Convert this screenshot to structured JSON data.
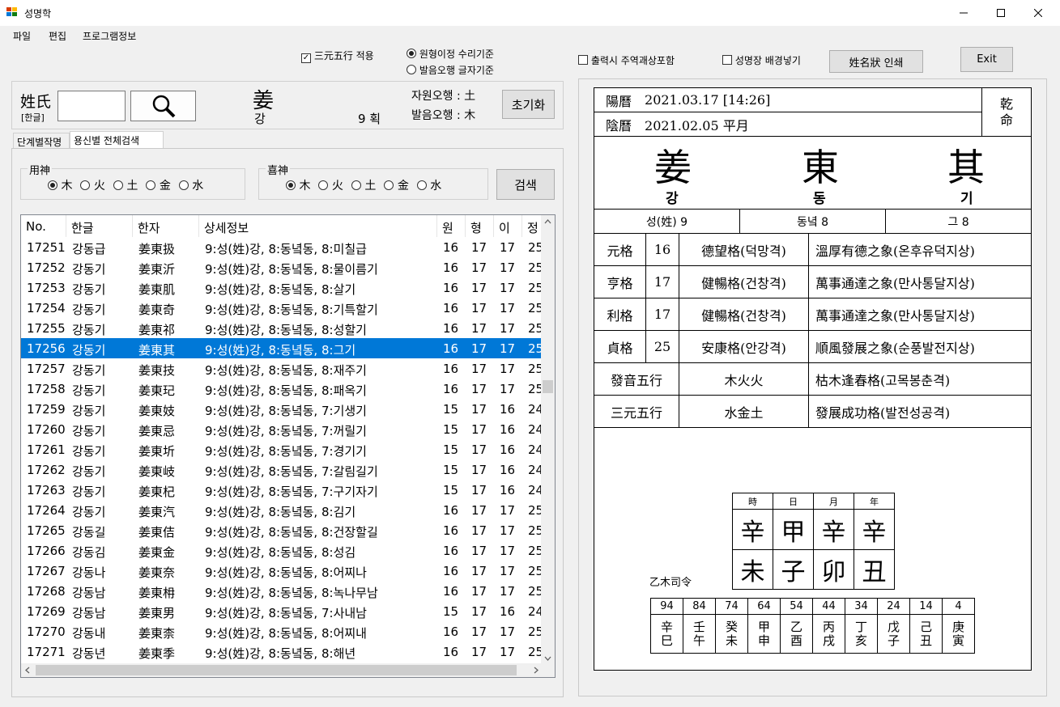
{
  "window": {
    "title": "성명학"
  },
  "menu": [
    "파일",
    "편집",
    "프로그램정보"
  ],
  "options": {
    "samwon_label": "三元五行 적용",
    "samwon_checked": true,
    "wonhyeong_label": "원형이정 수리기준",
    "baleum_label": "발음오행 글자기준",
    "print_label": "출력시 주역괘상포함",
    "bg_label": "성명장 배경넣기",
    "print_button": "姓名狀 인쇄",
    "exit_button": "Exit"
  },
  "surname": {
    "label": "姓氏",
    "sublabel": "[한글]",
    "input_value": "",
    "hanja": "姜",
    "hangul": "강",
    "strokes": "9 획",
    "jawon": "자원오행 : 土",
    "baleum": "발음오행 : 木",
    "reset_button": "초기화"
  },
  "tabs": [
    "단계별작명",
    "용신별 전체검색"
  ],
  "yongsin": {
    "title": "用神",
    "options": [
      "木",
      "火",
      "土",
      "金",
      "水"
    ],
    "selected": 0
  },
  "huisin": {
    "title": "喜神",
    "options": [
      "木",
      "火",
      "土",
      "金",
      "水"
    ],
    "selected": 0
  },
  "search_button": "검색",
  "grid": {
    "columns": [
      "No.",
      "한글",
      "한자",
      "상세정보",
      "원",
      "형",
      "이",
      "정"
    ],
    "selected_index": 5,
    "rows": [
      [
        "17251",
        "강동급",
        "姜東扱",
        "9:성(姓)강, 8:동녘동, 8:미칠급",
        "16",
        "17",
        "17",
        "25"
      ],
      [
        "17252",
        "강동기",
        "姜東沂",
        "9:성(姓)강, 8:동녘동, 8:물이름기",
        "16",
        "17",
        "17",
        "25"
      ],
      [
        "17253",
        "강동기",
        "姜東肌",
        "9:성(姓)강, 8:동녘동, 8:살기",
        "16",
        "17",
        "17",
        "25"
      ],
      [
        "17254",
        "강동기",
        "姜東奇",
        "9:성(姓)강, 8:동녘동, 8:기특할기",
        "16",
        "17",
        "17",
        "25"
      ],
      [
        "17255",
        "강동기",
        "姜東祁",
        "9:성(姓)강, 8:동녘동, 8:성할기",
        "16",
        "17",
        "17",
        "25"
      ],
      [
        "17256",
        "강동기",
        "姜東其",
        "9:성(姓)강, 8:동녘동, 8:그기",
        "16",
        "17",
        "17",
        "25"
      ],
      [
        "17257",
        "강동기",
        "姜東技",
        "9:성(姓)강, 8:동녘동, 8:재주기",
        "16",
        "17",
        "17",
        "25"
      ],
      [
        "17258",
        "강동기",
        "姜東玘",
        "9:성(姓)강, 8:동녘동, 8:패옥기",
        "16",
        "17",
        "17",
        "25"
      ],
      [
        "17259",
        "강동기",
        "姜東妓",
        "9:성(姓)강, 8:동녘동, 7:기생기",
        "15",
        "17",
        "16",
        "24"
      ],
      [
        "17260",
        "강동기",
        "姜東忌",
        "9:성(姓)강, 8:동녘동, 7:꺼릴기",
        "15",
        "17",
        "16",
        "24"
      ],
      [
        "17261",
        "강동기",
        "姜東圻",
        "9:성(姓)강, 8:동녘동, 7:경기기",
        "15",
        "17",
        "16",
        "24"
      ],
      [
        "17262",
        "강동기",
        "姜東岐",
        "9:성(姓)강, 8:동녘동, 7:갈림길기",
        "15",
        "17",
        "16",
        "24"
      ],
      [
        "17263",
        "강동기",
        "姜東杞",
        "9:성(姓)강, 8:동녘동, 7:구기자기",
        "15",
        "17",
        "16",
        "24"
      ],
      [
        "17264",
        "강동기",
        "姜東汽",
        "9:성(姓)강, 8:동녘동, 8:김기",
        "16",
        "17",
        "17",
        "25"
      ],
      [
        "17265",
        "강동길",
        "姜東佶",
        "9:성(姓)강, 8:동녘동, 8:건장할길",
        "16",
        "17",
        "17",
        "25"
      ],
      [
        "17266",
        "강동김",
        "姜東金",
        "9:성(姓)강, 8:동녘동, 8:성김",
        "16",
        "17",
        "17",
        "25"
      ],
      [
        "17267",
        "강동나",
        "姜東奈",
        "9:성(姓)강, 8:동녘동, 8:어찌나",
        "16",
        "17",
        "17",
        "25"
      ],
      [
        "17268",
        "강동남",
        "姜東枏",
        "9:성(姓)강, 8:동녘동, 8:녹나무남",
        "16",
        "17",
        "17",
        "25"
      ],
      [
        "17269",
        "강동남",
        "姜東男",
        "9:성(姓)강, 8:동녘동, 7:사내남",
        "15",
        "17",
        "16",
        "24"
      ],
      [
        "17270",
        "강동내",
        "姜東柰",
        "9:성(姓)강, 8:동녘동, 8:어찌내",
        "16",
        "17",
        "17",
        "25"
      ],
      [
        "17271",
        "강동년",
        "姜東季",
        "9:성(姓)강, 8:동녘동, 8:해년",
        "16",
        "17",
        "17",
        "25"
      ]
    ]
  },
  "report": {
    "yang_label": "陽曆",
    "yang_value": "2021.03.17 [14:26]",
    "eum_label": "陰曆",
    "eum_value": "2021.02.05 平月",
    "gender": "乾\n命",
    "name": [
      {
        "hanja": "姜",
        "hangul": "강"
      },
      {
        "hanja": "東",
        "hangul": "동"
      },
      {
        "hanja": "其",
        "hangul": "기"
      }
    ],
    "strokes": [
      "성(姓) 9",
      "동녘 8",
      "그 8"
    ],
    "grades": [
      {
        "label": "元格",
        "num": "16",
        "name": "德望格(덕망격)",
        "desc": "溫厚有德之象(온후유덕지상)"
      },
      {
        "label": "亨格",
        "num": "17",
        "name": "健暢格(건창격)",
        "desc": "萬事通達之象(만사통달지상)"
      },
      {
        "label": "利格",
        "num": "17",
        "name": "健暢格(건창격)",
        "desc": "萬事通達之象(만사통달지상)"
      },
      {
        "label": "貞格",
        "num": "25",
        "name": "安康格(안강격)",
        "desc": "順風發展之象(순풍발전지상)"
      }
    ],
    "baleum": {
      "label": "發音五行",
      "value": "木火火",
      "desc": "枯木逢春格(고목봉춘격)"
    },
    "samwon": {
      "label": "三元五行",
      "value": "水金土",
      "desc": "發展成功格(발전성공격)"
    },
    "saju_head": [
      "時",
      "日",
      "月",
      "年"
    ],
    "saju_top": [
      "辛",
      "甲",
      "辛",
      "辛"
    ],
    "saju_bottom": [
      "未",
      "子",
      "卯",
      "丑"
    ],
    "saryeong": "乙木司令",
    "daeun_ages": [
      "94",
      "84",
      "74",
      "64",
      "54",
      "44",
      "34",
      "24",
      "14",
      "4"
    ],
    "daeun_top": [
      "辛",
      "壬",
      "癸",
      "甲",
      "乙",
      "丙",
      "丁",
      "戊",
      "己",
      "庚"
    ],
    "daeun_bottom": [
      "巳",
      "午",
      "未",
      "申",
      "酉",
      "戌",
      "亥",
      "子",
      "丑",
      "寅"
    ]
  }
}
